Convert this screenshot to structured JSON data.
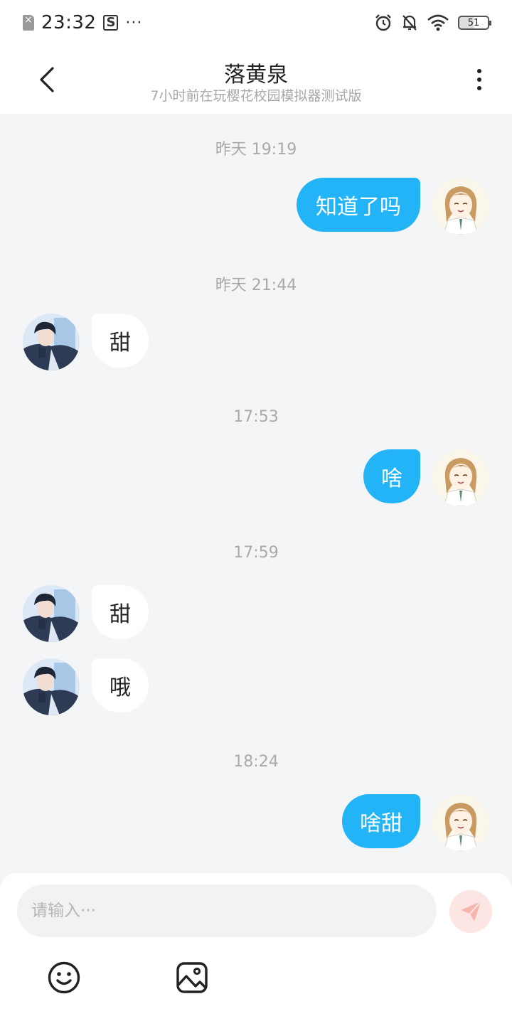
{
  "status_bar": {
    "time": "23:32",
    "dots": "···",
    "s_label": "S",
    "battery": "51"
  },
  "header": {
    "title": "落黄泉",
    "subtitle": "7小时前在玩樱花校园模拟器测试版"
  },
  "messages": [
    {
      "type": "time",
      "text": "昨天 19:19"
    },
    {
      "type": "out",
      "text": "知道了吗"
    },
    {
      "type": "time",
      "text": "昨天 21:44"
    },
    {
      "type": "in",
      "text": "甜"
    },
    {
      "type": "time",
      "text": "17:53"
    },
    {
      "type": "out",
      "text": "啥"
    },
    {
      "type": "time",
      "text": "17:59"
    },
    {
      "type": "in",
      "text": "甜"
    },
    {
      "type": "in",
      "text": "哦"
    },
    {
      "type": "time",
      "text": "18:24"
    },
    {
      "type": "out",
      "text": "啥甜"
    }
  ],
  "input": {
    "placeholder": "请输入···",
    "value": ""
  },
  "icons": {
    "back": "chevron-left-icon",
    "more": "more-vertical-icon",
    "send": "paper-plane-icon",
    "emoji": "smiley-icon",
    "image": "image-icon"
  },
  "colors": {
    "outgoing_bubble": "#22b4f6",
    "incoming_bubble": "#ffffff",
    "background": "#f4f5f7",
    "send_button": "#fde5e3",
    "send_icon": "#f7b4ad"
  }
}
